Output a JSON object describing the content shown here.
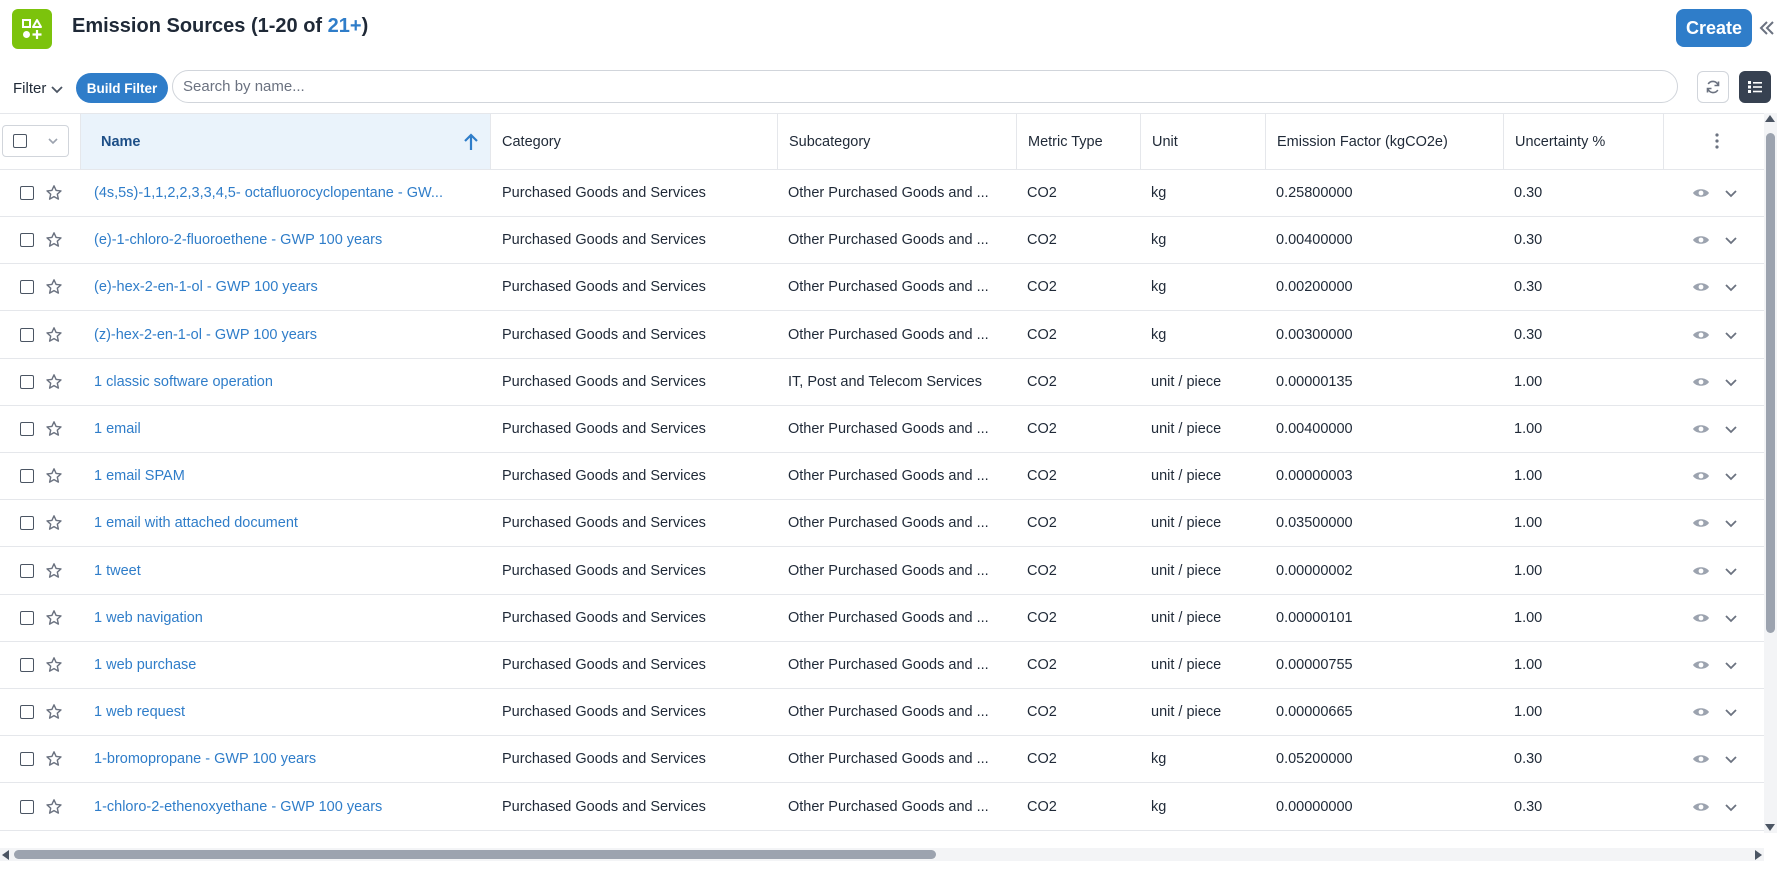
{
  "header": {
    "title": "Emission Sources (1-20 of ",
    "count": "21+",
    "title_suffix": ")",
    "create_label": "Create",
    "logo_icon": "apps-grid-icon",
    "collapse_icon": "double-chevron-left-icon"
  },
  "filterbar": {
    "filter_label": "Filter",
    "build_filter_label": "Build Filter",
    "search_placeholder": "Search by name...",
    "search_value": ""
  },
  "table": {
    "columns": [
      {
        "label": "Name",
        "sorted": "ascending"
      },
      {
        "label": "Category"
      },
      {
        "label": "Subcategory"
      },
      {
        "label": "Metric Type"
      },
      {
        "label": "Unit"
      },
      {
        "label": "Emission Factor (kgCO2e)"
      },
      {
        "label": "Uncertainty %"
      }
    ],
    "rows": [
      {
        "name": "(4s,5s)-1,1,2,2,3,3,4,5- octafluorocyclopentane - GW...",
        "category": "Purchased Goods and Services",
        "subcategory": "Other Purchased Goods and ...",
        "metric": "CO2",
        "unit": "kg",
        "factor": "0.25800000",
        "uncertainty": "0.30"
      },
      {
        "name": "(e)-1-chloro-2-fluoroethene - GWP 100 years",
        "category": "Purchased Goods and Services",
        "subcategory": "Other Purchased Goods and ...",
        "metric": "CO2",
        "unit": "kg",
        "factor": "0.00400000",
        "uncertainty": "0.30"
      },
      {
        "name": "(e)-hex-2-en-1-ol - GWP 100 years",
        "category": "Purchased Goods and Services",
        "subcategory": "Other Purchased Goods and ...",
        "metric": "CO2",
        "unit": "kg",
        "factor": "0.00200000",
        "uncertainty": "0.30"
      },
      {
        "name": "(z)-hex-2-en-1-ol - GWP 100 years",
        "category": "Purchased Goods and Services",
        "subcategory": "Other Purchased Goods and ...",
        "metric": "CO2",
        "unit": "kg",
        "factor": "0.00300000",
        "uncertainty": "0.30"
      },
      {
        "name": "1 classic software operation",
        "category": "Purchased Goods and Services",
        "subcategory": "IT, Post and Telecom Services",
        "metric": "CO2",
        "unit": "unit / piece",
        "factor": "0.00000135",
        "uncertainty": "1.00"
      },
      {
        "name": "1 email",
        "category": "Purchased Goods and Services",
        "subcategory": "Other Purchased Goods and ...",
        "metric": "CO2",
        "unit": "unit / piece",
        "factor": "0.00400000",
        "uncertainty": "1.00"
      },
      {
        "name": "1 email SPAM",
        "category": "Purchased Goods and Services",
        "subcategory": "Other Purchased Goods and ...",
        "metric": "CO2",
        "unit": "unit / piece",
        "factor": "0.00000003",
        "uncertainty": "1.00"
      },
      {
        "name": "1 email with attached document",
        "category": "Purchased Goods and Services",
        "subcategory": "Other Purchased Goods and ...",
        "metric": "CO2",
        "unit": "unit / piece",
        "factor": "0.03500000",
        "uncertainty": "1.00"
      },
      {
        "name": "1 tweet",
        "category": "Purchased Goods and Services",
        "subcategory": "Other Purchased Goods and ...",
        "metric": "CO2",
        "unit": "unit / piece",
        "factor": "0.00000002",
        "uncertainty": "1.00"
      },
      {
        "name": "1 web navigation",
        "category": "Purchased Goods and Services",
        "subcategory": "Other Purchased Goods and ...",
        "metric": "CO2",
        "unit": "unit / piece",
        "factor": "0.00000101",
        "uncertainty": "1.00"
      },
      {
        "name": "1 web purchase",
        "category": "Purchased Goods and Services",
        "subcategory": "Other Purchased Goods and ...",
        "metric": "CO2",
        "unit": "unit / piece",
        "factor": "0.00000755",
        "uncertainty": "1.00"
      },
      {
        "name": "1 web request",
        "category": "Purchased Goods and Services",
        "subcategory": "Other Purchased Goods and ...",
        "metric": "CO2",
        "unit": "unit / piece",
        "factor": "0.00000665",
        "uncertainty": "1.00"
      },
      {
        "name": "1-bromopropane - GWP 100 years",
        "category": "Purchased Goods and Services",
        "subcategory": "Other Purchased Goods and ...",
        "metric": "CO2",
        "unit": "kg",
        "factor": "0.05200000",
        "uncertainty": "0.30"
      },
      {
        "name": "1-chloro-2-ethenoxyethane - GWP 100 years",
        "category": "Purchased Goods and Services",
        "subcategory": "Other Purchased Goods and ...",
        "metric": "CO2",
        "unit": "kg",
        "factor": "0.00000000",
        "uncertainty": "0.30"
      }
    ]
  },
  "colors": {
    "accent": "#2f7dc9",
    "logo": "#7cc30c",
    "sorted_header_bg": "#eaf3fb"
  }
}
